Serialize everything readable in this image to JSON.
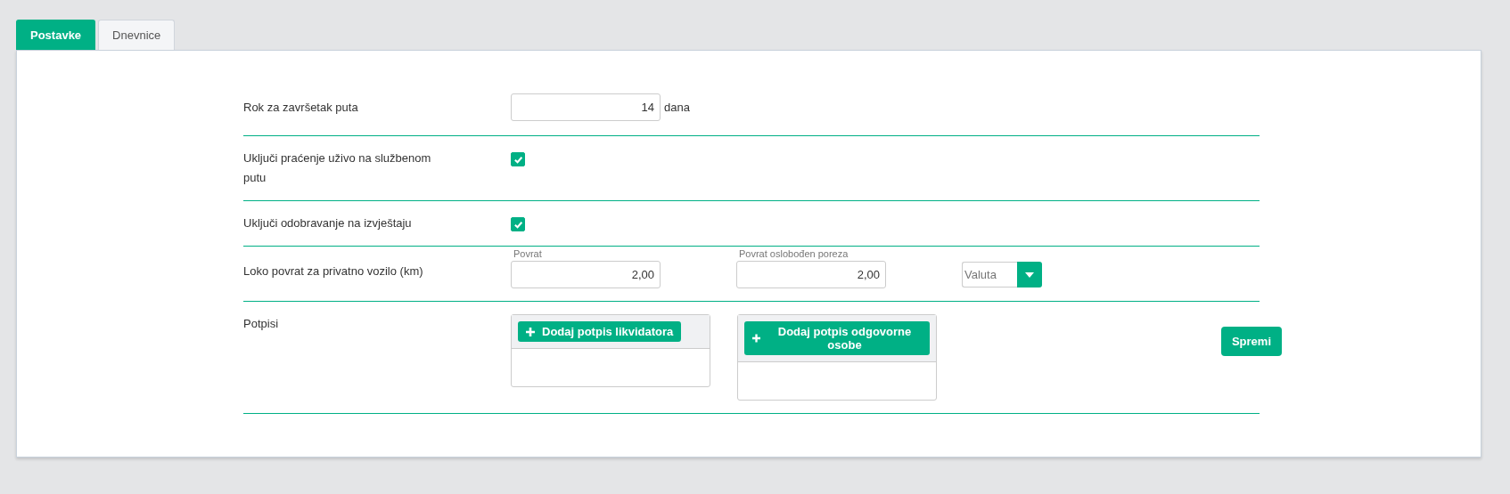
{
  "tabs": [
    {
      "label": "Postavke",
      "selected": true
    },
    {
      "label": "Dnevnice",
      "selected": false
    }
  ],
  "rows": [
    {
      "kind": "number",
      "label": "Rok za završetak puta",
      "value": "14",
      "unit": "dana"
    },
    {
      "kind": "checkbox",
      "label": "Uključi praćenje uživo na službenom putu",
      "checked": true
    },
    {
      "kind": "checkbox",
      "label": "Uključi odobravanje na izvještaju",
      "checked": true
    },
    {
      "kind": "amounts",
      "label": "Loko povrat za privatno vozilo (km)",
      "fields": [
        {
          "caption": "Povrat",
          "value": "2,00"
        },
        {
          "caption": "Povrat oslobođen poreza",
          "value": "2,00"
        }
      ],
      "currency": {
        "placeholder": "Valuta"
      }
    },
    {
      "kind": "signatures",
      "label": "Potpisi",
      "buttons": [
        "Dodaj potpis likvidatora",
        "Dodaj potpis odgovorne osobe"
      ],
      "save": "Spremi"
    }
  ]
}
